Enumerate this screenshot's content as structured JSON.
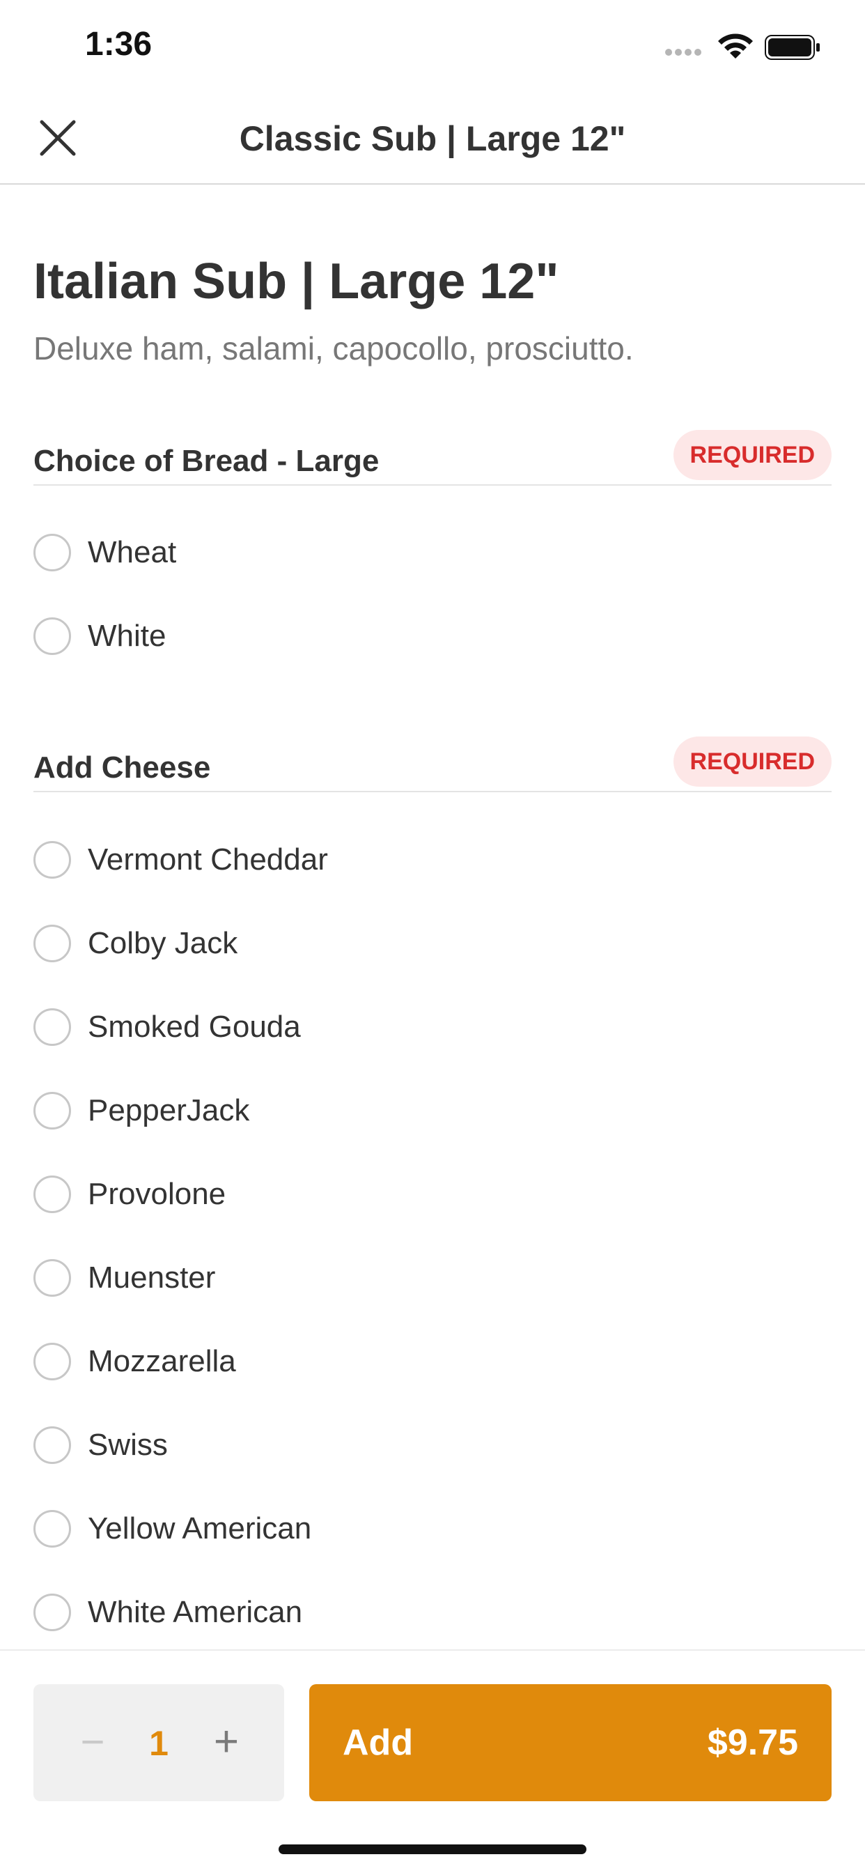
{
  "status_bar": {
    "time": "1:36"
  },
  "nav": {
    "title": "Classic Sub | Large 12\""
  },
  "item": {
    "title": "Italian Sub | Large 12\"",
    "description": "Deluxe ham, salami, capocollo, prosciutto."
  },
  "sections": [
    {
      "title": "Choice of Bread - Large",
      "badge": "REQUIRED",
      "options": [
        "Wheat",
        "White"
      ]
    },
    {
      "title": "Add Cheese",
      "badge": "REQUIRED",
      "options": [
        "Vermont Cheddar",
        "Colby Jack",
        "Smoked Gouda",
        "PepperJack",
        "Provolone",
        "Muenster",
        "Mozzarella",
        "Swiss",
        "Yellow American",
        "White American"
      ]
    }
  ],
  "footer": {
    "quantity": "1",
    "minus_label": "−",
    "plus_label": "+",
    "add_label": "Add",
    "price": "$9.75"
  },
  "colors": {
    "accent": "#e08a0c",
    "required_text": "#d82c2c",
    "required_bg": "#fde7e7"
  }
}
